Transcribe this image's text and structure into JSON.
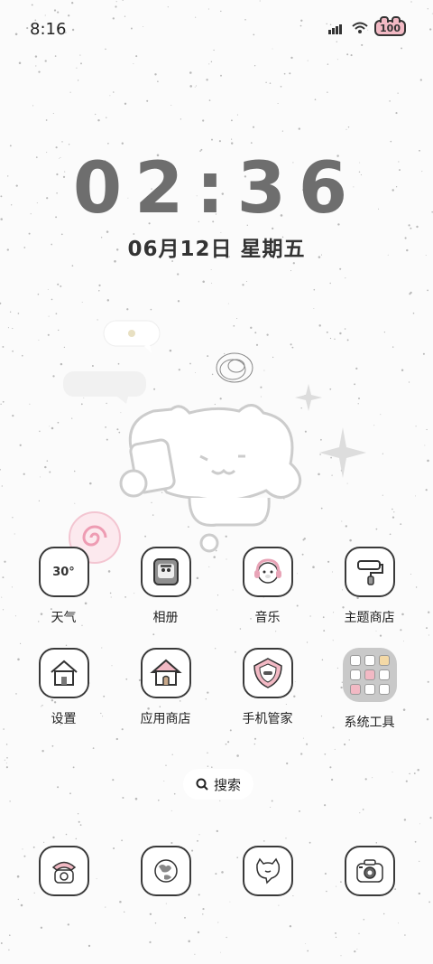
{
  "status": {
    "time": "8:16",
    "battery": "100"
  },
  "clock": {
    "time": "02:36",
    "date": "06月12日 星期五"
  },
  "apps": {
    "weather": {
      "label": "天气",
      "temp": "30°"
    },
    "gallery": {
      "label": "相册"
    },
    "music": {
      "label": "音乐"
    },
    "theme_store": {
      "label": "主题商店"
    },
    "settings": {
      "label": "设置"
    },
    "app_store": {
      "label": "应用商店"
    },
    "phone_manager": {
      "label": "手机管家"
    },
    "system_tools": {
      "label": "系统工具"
    }
  },
  "search": {
    "label": "搜索"
  },
  "dock": [
    "phone-icon",
    "browser-icon",
    "messages-icon",
    "camera-icon"
  ],
  "colors": {
    "accent_pink": "#f2b9c4",
    "icon_stroke": "#3a3a3a",
    "clock_gray": "#6e6e6e"
  }
}
